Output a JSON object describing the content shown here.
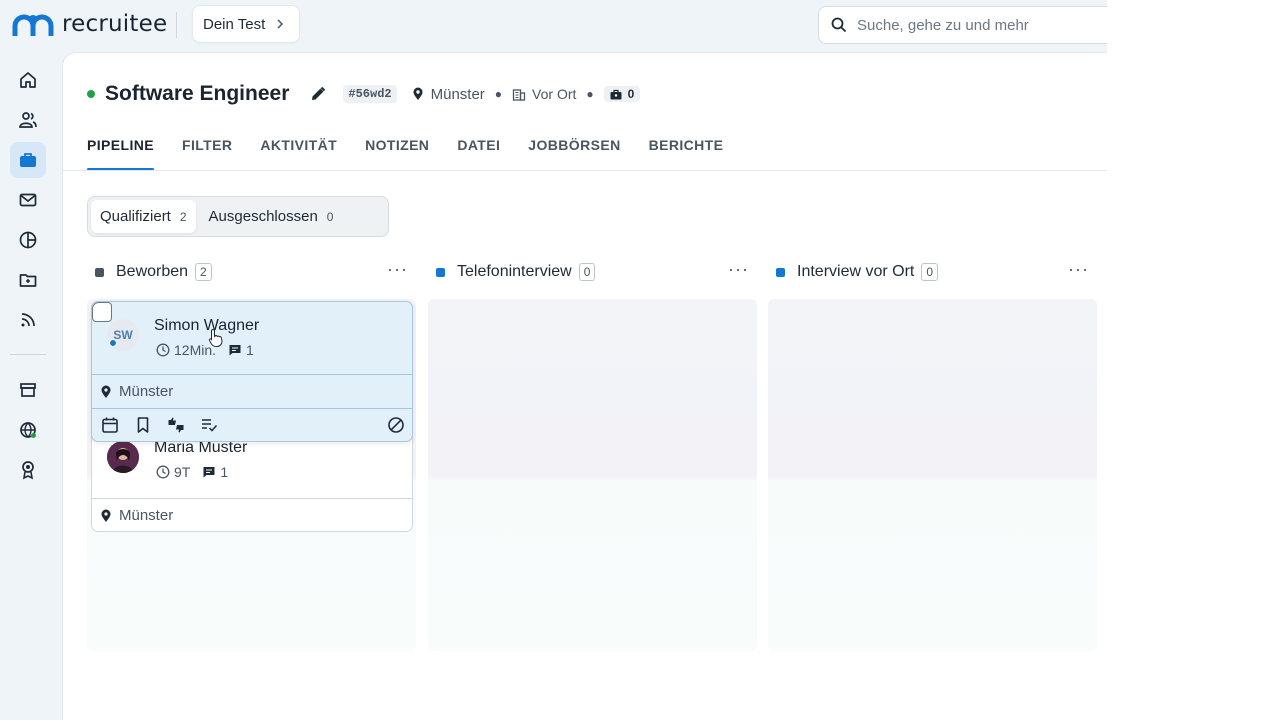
{
  "app": {
    "logo_text": "recruitee"
  },
  "topbar": {
    "test_label": "Dein Test",
    "search_placeholder": "Suche, gehe zu und mehr"
  },
  "job": {
    "title": "Software Engineer",
    "code": "#56wd2",
    "location": "Münster",
    "workplace": "Vor Ort",
    "openings": "0"
  },
  "tabs": [
    "PIPELINE",
    "FILTER",
    "AKTIVITÄT",
    "NOTIZEN",
    "DATEI",
    "JOBBÖRSEN",
    "BERICHTE"
  ],
  "segment": {
    "qualified_label": "Qualifiziert",
    "qualified_count": "2",
    "excluded_label": "Ausgeschlossen",
    "excluded_count": "0"
  },
  "columns": [
    {
      "name": "Beworben",
      "count": "2",
      "color": "#4a5561"
    },
    {
      "name": "Telefoninterview",
      "count": "0",
      "color": "#1677d2"
    },
    {
      "name": "Interview vor Ort",
      "count": "0",
      "color": "#1677d2"
    }
  ],
  "more_label": "···",
  "candidates": [
    {
      "name": "Simon Wagner",
      "initials": "SW",
      "time": "12Min.",
      "messages": "1",
      "location": "Münster"
    },
    {
      "name": "Maria Muster",
      "time": "9T",
      "messages": "1",
      "location": "Münster"
    }
  ],
  "colors": {
    "accent": "#1677d2",
    "status_green": "#1fa04b",
    "hover_card": "#e2f0fa"
  }
}
